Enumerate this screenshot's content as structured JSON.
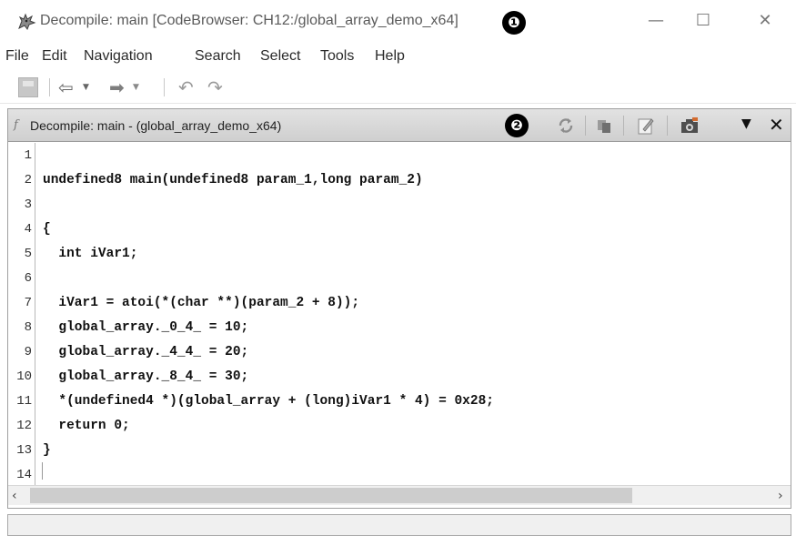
{
  "window": {
    "title": "Decompile: main [CodeBrowser: CH12:/global_array_demo_x64]",
    "callout_1": "❶",
    "minimize_glyph": "—",
    "maximize_glyph": "☐",
    "close_glyph": "✕"
  },
  "menu": [
    "File",
    "Edit",
    "Navigation",
    "Search",
    "Select",
    "Tools",
    "Help"
  ],
  "toolbar": {
    "icons": [
      "save-icon",
      "back-arrow-icon",
      "forward-arrow-icon",
      "undo-icon",
      "redo-icon"
    ],
    "back_glyph": "⇦",
    "fwd_glyph": "➡",
    "dropdown_glyph": "▼",
    "undo_glyph": "↶",
    "redo_glyph": "↷"
  },
  "panel": {
    "icon_glyph": "f",
    "title": "Decompile: main -  (global_array_demo_x64)",
    "callout_2": "❷",
    "header_icons": [
      "refresh-icon",
      "copy-icon",
      "edit-icon",
      "snapshot-icon",
      "menu-dropdown-icon",
      "close-icon"
    ],
    "menu_glyph": "▼",
    "close_glyph": "✕"
  },
  "code": {
    "line_numbers": [
      "1",
      "2",
      "3",
      "4",
      "5",
      "6",
      "7",
      "8",
      "9",
      "10",
      "11",
      "12",
      "13",
      "14"
    ],
    "lines": [
      "",
      "undefined8 main(undefined8 param_1,long param_2)",
      "",
      "{",
      "  int iVar1;",
      "",
      "  iVar1 = atoi(*(char **)(param_2 + 8));",
      "  global_array._0_4_ = 10;",
      "  global_array._4_4_ = 20;",
      "  global_array._8_4_ = 30;",
      "  *(undefined4 *)(global_array + (long)iVar1 * 4) = 0x28;",
      "  return 0;",
      "}",
      ""
    ]
  },
  "scrollbar": {
    "left_glyph": "‹",
    "right_glyph": "›"
  }
}
